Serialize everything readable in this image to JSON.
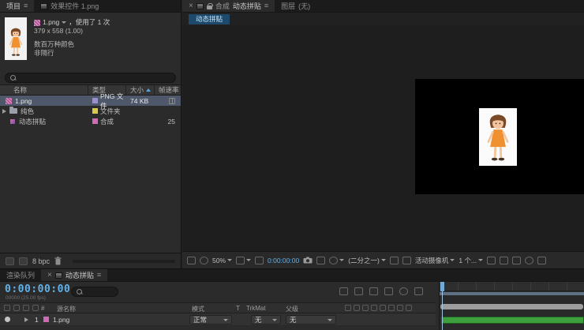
{
  "icons": {
    "menu": "≡",
    "close": "×"
  },
  "colors": {
    "timecode_blue": "#62b1e8",
    "selection_bg": "#4e586a",
    "chip_bg": "#1d4a6c",
    "green_layer_bar": "#3da03d",
    "workarea_bar": "#5d7183",
    "navigator_bar": "#9d9d9d",
    "label_lavender": "#9b8fd0",
    "label_yellow": "#d9c94a",
    "label_pink": "#cf6ab4"
  },
  "project": {
    "tabs": [
      {
        "label": "项目"
      },
      {
        "label": "效果控件 1.png"
      }
    ],
    "preview": {
      "name": "1.png",
      "usage": "，使用了 1 次",
      "dimensions": "379 x 558 (1.00)",
      "color_depth": "数百万种颜色",
      "interlace": "非隔行"
    },
    "columns": {
      "name": "名称",
      "type": "类型",
      "size": "大小",
      "fps": "帧速率"
    },
    "rows": [
      {
        "name": "1.png",
        "type": "PNG 文件",
        "size": "74 KB",
        "fps": ""
      },
      {
        "name": "纯色",
        "type": "文件夹",
        "size": "",
        "fps": ""
      },
      {
        "name": "动态拼贴",
        "type": "合成",
        "size": "",
        "fps": "25"
      }
    ],
    "footer": {
      "bit_depth": "8 bpc"
    }
  },
  "viewer": {
    "panel_type": "合成",
    "comp_name": "动态拼贴",
    "layer_tab": "图层",
    "layer_tab_value": "(无)",
    "nav_chip": "动态拼贴",
    "toolbar": {
      "zoom": "50%",
      "timecode": "0:00:00:00",
      "resolution": "(二分之一)",
      "camera_view": "活动摄像机",
      "view_count": "1 个..."
    }
  },
  "timeline": {
    "tabs": [
      {
        "label": "渲染队列"
      },
      {
        "label": "动态拼贴"
      }
    ],
    "timecode": "0:00:00:00",
    "frame_info": "00000 (25.00 fps)",
    "columns": {
      "index": "#",
      "source": "源名称",
      "mode": "模式",
      "t": "T",
      "trkmat": "TrkMat",
      "parent": "父级"
    },
    "layer": {
      "index": "1",
      "name": "1.png",
      "mode": "正常",
      "trkmat": "无",
      "parent": "无"
    }
  }
}
